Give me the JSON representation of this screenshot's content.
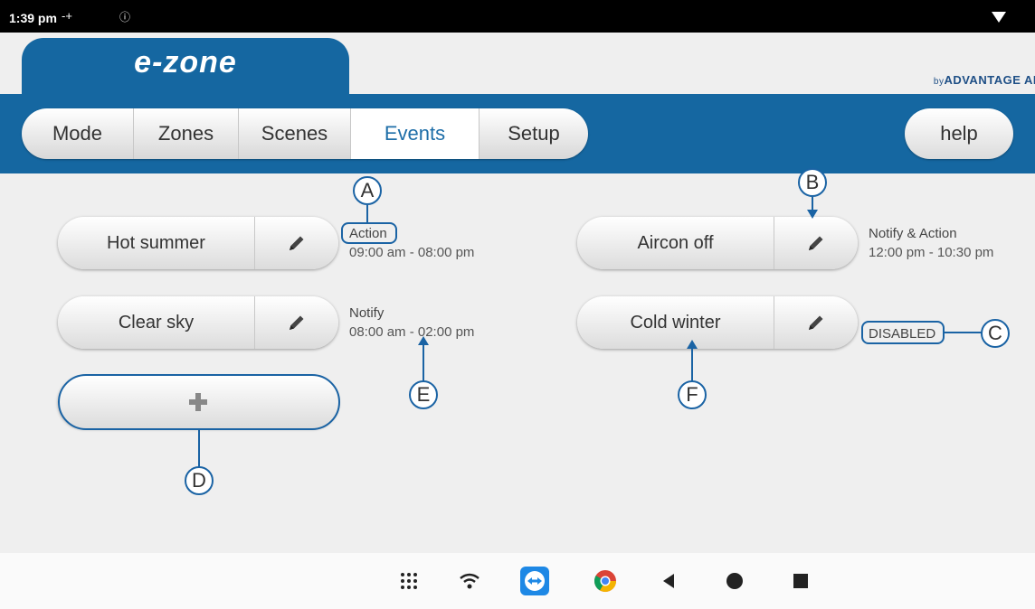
{
  "status_bar": {
    "time": "1:39 pm",
    "indicator_1": "-+",
    "indicator_2": "ⓘ"
  },
  "app": {
    "logo": "e-zone",
    "brand_prefix": "by",
    "brand": "ADVANTAGE AI"
  },
  "nav": {
    "tabs": [
      {
        "label": "Mode"
      },
      {
        "label": "Zones"
      },
      {
        "label": "Scenes"
      },
      {
        "label": "Events",
        "active": true
      },
      {
        "label": "Setup"
      }
    ],
    "help_label": "help"
  },
  "events": [
    {
      "name": "Hot summer",
      "type": "Action",
      "time": "09:00 am - 08:00 pm"
    },
    {
      "name": "Clear sky",
      "type": "Notify",
      "time": "08:00 am - 02:00 pm"
    },
    {
      "name": "Aircon off",
      "type": "Notify & Action",
      "time": "12:00 pm - 10:30 pm"
    },
    {
      "name": "Cold winter",
      "type": "DISABLED",
      "time": ""
    }
  ],
  "add_button": {
    "icon": "plus-icon"
  },
  "callouts": {
    "a": "A",
    "b": "B",
    "c": "C",
    "d": "D",
    "e": "E",
    "f": "F"
  },
  "icons": {
    "edit": "pencil-icon",
    "apps": "apps-grid-icon",
    "wifi": "wifi-icon",
    "teamviewer": "teamviewer-icon",
    "chrome": "chrome-icon",
    "back": "back-icon",
    "home": "home-icon",
    "recents": "recents-icon"
  },
  "colors": {
    "brand_blue": "#1567a1",
    "active_tab_text": "#1e6ea8",
    "annotation_blue": "#1a63a4"
  }
}
